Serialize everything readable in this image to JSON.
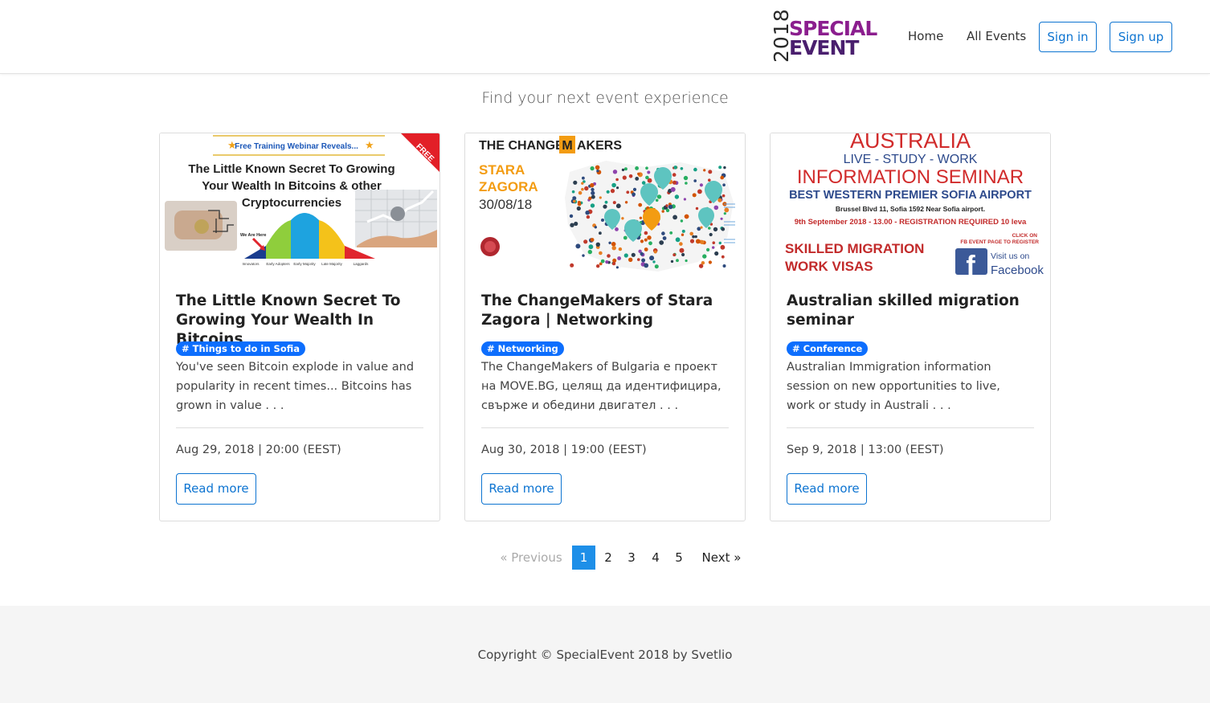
{
  "header": {
    "logo": {
      "year": "2018",
      "word1": "SPECIAL",
      "word2": "EVENT"
    },
    "nav": {
      "home": "Home",
      "all_events": "All Events"
    },
    "sign_in": "Sign in",
    "sign_up": "Sign up"
  },
  "tagline": "Find your next event experience",
  "events": [
    {
      "title": "The Little Known Secret To Growing Your Wealth In Bitcoins",
      "category": "# Things to do in Sofia",
      "description": "You've seen Bitcoin explode in value and popularity in recent times... Bitcoins has grown in value . . .",
      "datetime": "Aug 29, 2018 | 20:00 (EEST)",
      "button": "Read more",
      "image": {
        "banner": "Free Training Webinar Reveals...",
        "ribbon": "FREE",
        "headline": [
          "The Little Known Secret To Growing",
          "Your Wealth In Bitcoins & other",
          "Cryptocurrencies"
        ],
        "marker": "We Are Here",
        "curve_labels": [
          "Innovators",
          "Early Adopters",
          "Early Majority",
          "Late Majority",
          "Laggards"
        ],
        "colors": [
          "#1a3d8f",
          "#8fce3c",
          "#1ea3df",
          "#f4c21a",
          "#e0262e"
        ]
      }
    },
    {
      "title": "The ChangeMakers of Stara Zagora | Networking",
      "category": "# Networking",
      "description": "The ChangeMakers of Bulgaria е проект на MOVE.BG, целящ да идентифицира, свърже и обедини двигател . . .",
      "datetime": "Aug 30, 2018 | 19:00 (EEST)",
      "button": "Read more",
      "image": {
        "brand_pre": "THE CHANGE",
        "brand_m": "M",
        "brand_post": "AKERS",
        "city1": "STARA",
        "city2": "ZAGORA",
        "date": "30/08/18",
        "accent": "#f39c12"
      }
    },
    {
      "title": "Australian skilled migration seminar",
      "category": "# Conference",
      "description": "Australian Immigration information session on new opportunities to live, work or study in Australi . . .",
      "datetime": "Sep 9, 2018 | 13:00 (EEST)",
      "button": "Read more",
      "image": {
        "line1": "AUSTRALIA",
        "line2": "LIVE  -  STUDY  -  WORK",
        "line3": "INFORMATION   SEMINAR",
        "line4": "BEST WESTERN PREMIER SOFIA AIRPORT",
        "line5": "Brussel Blvd 11, Sofia 1592 Near Sofia airport.",
        "line6": "9th September 2018 - 13.00  -  REGISTRATION REQUIRED 10 leva",
        "line7": "SKILLED MIGRATION",
        "line8": "WORK VISAS",
        "click1": "CLICK ON",
        "click2": "FB EVENT PAGE TO REGISTER",
        "fb1": "Visit us on",
        "fb2": "Facebook"
      }
    }
  ],
  "pagination": {
    "prev": "«  Previous",
    "pages": [
      "1",
      "2",
      "3",
      "4",
      "5"
    ],
    "active_page": "1",
    "next": "Next  »"
  },
  "footer": {
    "copyright": "Copyright © SpecialEvent 2018 by Svetlio"
  },
  "colors": {
    "primary": "#0d74d1",
    "badge": "#0d6efd",
    "active_page": "#1e8fe8"
  }
}
